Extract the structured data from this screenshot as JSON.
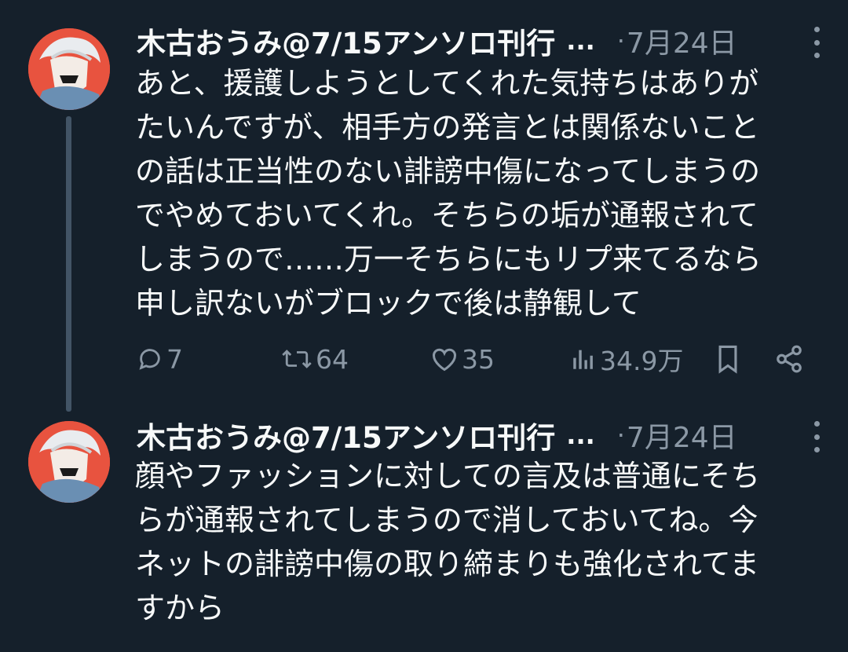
{
  "tweets": [
    {
      "author": "木古おうみ@7/15アンソロ刊行",
      "ellipsis": "...",
      "dot": "·",
      "date": "7月24日",
      "lines": [
        "あと、援護しようとしてくれた気持ちはありが",
        "たいんですが、相手方の発言とは関係ないこと",
        "の話は正当性のない誹謗中傷になってしまうの",
        "でやめておいてくれ。そちらの垢が通報されて",
        "しまうので……万一そちらにもリプ来てるなら",
        "申し訳ないがブロックで後は静観して"
      ],
      "actions": {
        "replies": "7",
        "retweets": "64",
        "likes": "35",
        "views": "34.9万"
      }
    },
    {
      "author": "木古おうみ@7/15アンソロ刊行",
      "ellipsis": "...",
      "dot": "·",
      "date": "7月24日",
      "lines": [
        "顔やファッションに対しての言及は普通にそち",
        "らが通報されてしまうので消しておいてね。今",
        "ネットの誹謗中傷の取り締まりも強化されてま",
        "すから"
      ]
    }
  ],
  "icons": {
    "more": "more-vertical-icon",
    "reply": "reply-icon",
    "retweet": "retweet-icon",
    "like": "heart-icon",
    "views": "views-icon",
    "bookmark": "bookmark-icon",
    "share": "share-icon"
  },
  "colors": {
    "background": "#15202b",
    "text": "#f7f9f9",
    "muted": "#8b98a5",
    "thread_line": "#425466",
    "avatar_bg": "#e8533f"
  }
}
